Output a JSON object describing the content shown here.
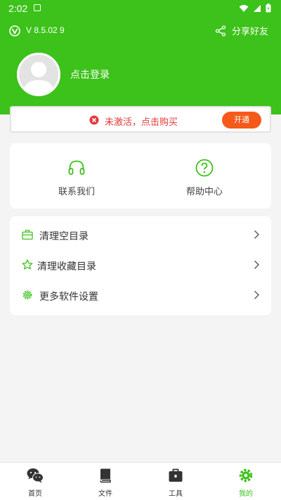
{
  "status_bar": {
    "time": "2:02"
  },
  "topbar": {
    "version": "V 8.5.02   9",
    "share_label": "分享好友"
  },
  "profile": {
    "login_label": "点击登录"
  },
  "activation": {
    "message": "未激活，点击购买",
    "button_label": "开通"
  },
  "help": [
    {
      "label": "联系我们",
      "icon": "headset-icon"
    },
    {
      "label": "帮助中心",
      "icon": "question-circle-icon"
    }
  ],
  "menu": [
    {
      "label": "清理空目录",
      "icon": "briefcase-icon"
    },
    {
      "label": "清理收藏目录",
      "icon": "star-icon"
    },
    {
      "label": "更多软件设置",
      "icon": "gear-icon"
    }
  ],
  "bottom_nav": [
    {
      "label": "首页",
      "icon": "wechat-icon",
      "active": false
    },
    {
      "label": "文件",
      "icon": "book-icon",
      "active": false
    },
    {
      "label": "工具",
      "icon": "toolbox-icon",
      "active": false
    },
    {
      "label": "我的",
      "icon": "gear-icon",
      "active": true
    }
  ],
  "colors": {
    "brand_green": "#3cc21a",
    "warning_red": "#e23a3a",
    "button_orange": "#f55a1b",
    "background": "#f4f4f4"
  }
}
